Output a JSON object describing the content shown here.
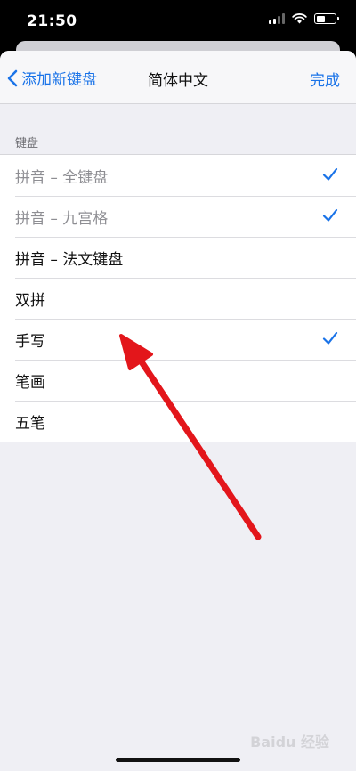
{
  "status": {
    "time": "21:50"
  },
  "nav": {
    "back_label": "添加新键盘",
    "title": "简体中文",
    "done_label": "完成"
  },
  "section": {
    "header": "键盘"
  },
  "keyboards": [
    {
      "label": "拼音 – 全键盘",
      "checked": true,
      "disabled": true
    },
    {
      "label": "拼音 – 九宫格",
      "checked": true,
      "disabled": true
    },
    {
      "label": "拼音 – 法文键盘",
      "checked": false,
      "disabled": false
    },
    {
      "label": "双拼",
      "checked": false,
      "disabled": false
    },
    {
      "label": "手写",
      "checked": true,
      "disabled": false
    },
    {
      "label": "笔画",
      "checked": false,
      "disabled": false
    },
    {
      "label": "五笔",
      "checked": false,
      "disabled": false
    }
  ],
  "colors": {
    "accent": "#1a73e8",
    "arrow": "#e3161b"
  },
  "icons": {
    "back": "chevron-left-icon",
    "check": "checkmark-icon",
    "wifi": "wifi-icon",
    "battery": "battery-icon",
    "signal": "signal-icon",
    "arrow": "red-arrow-annotation"
  },
  "watermark": "Baidu 经验"
}
